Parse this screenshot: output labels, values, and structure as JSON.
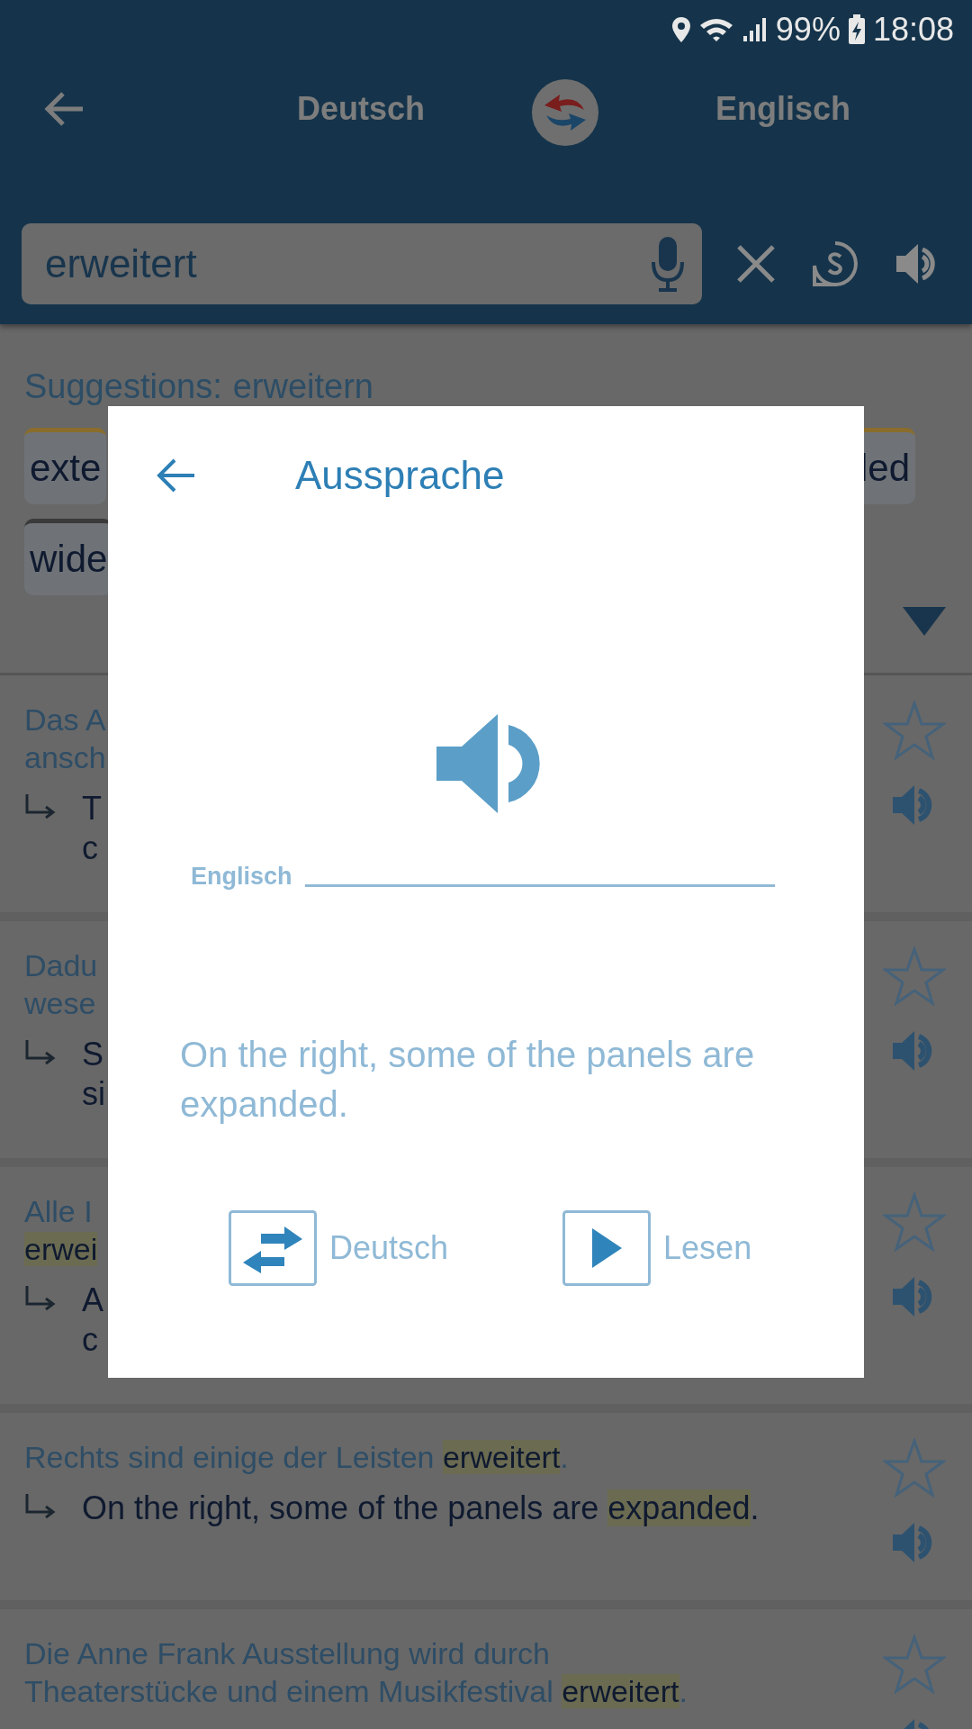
{
  "status_bar": {
    "battery": "99%",
    "time": "18:08"
  },
  "toolbar": {
    "source_language": "Deutsch",
    "target_language": "Englisch"
  },
  "search": {
    "value": "erweitert"
  },
  "suggestions": {
    "label": "Suggestions:",
    "word": "erweitern",
    "chip_rows": [
      [
        {
          "text": "exte",
          "color": "#8a6d2c"
        },
        {
          "text": "led",
          "color": "#8a6d2c"
        }
      ],
      [
        {
          "text": "wide",
          "color": "#3a3a3a"
        }
      ]
    ]
  },
  "results": [
    {
      "source": [
        "Das A",
        "ansch"
      ],
      "target": [
        "T",
        "c"
      ]
    },
    {
      "source": [
        "Dadu",
        "wese"
      ],
      "target": [
        "S",
        "si"
      ]
    },
    {
      "source": [
        "Alle I",
        "**erwei**"
      ],
      "target": [
        "A",
        "c"
      ]
    },
    {
      "source": [
        "Rechts sind einige der Leisten **erweitert**."
      ],
      "target": [
        "On the right, some of the panels are **expanded**."
      ]
    },
    {
      "source": [
        "Die Anne Frank Ausstellung wird durch",
        "Theaterstücke und einem Musikfestival **erweitert**."
      ]
    }
  ],
  "dialog": {
    "title": "Aussprache",
    "language_label": "Englisch",
    "sentence": "On the right, some of the panels are expanded.",
    "buttons": [
      {
        "kind": "swap",
        "label": "Deutsch"
      },
      {
        "kind": "play",
        "label": "Lesen"
      }
    ]
  }
}
